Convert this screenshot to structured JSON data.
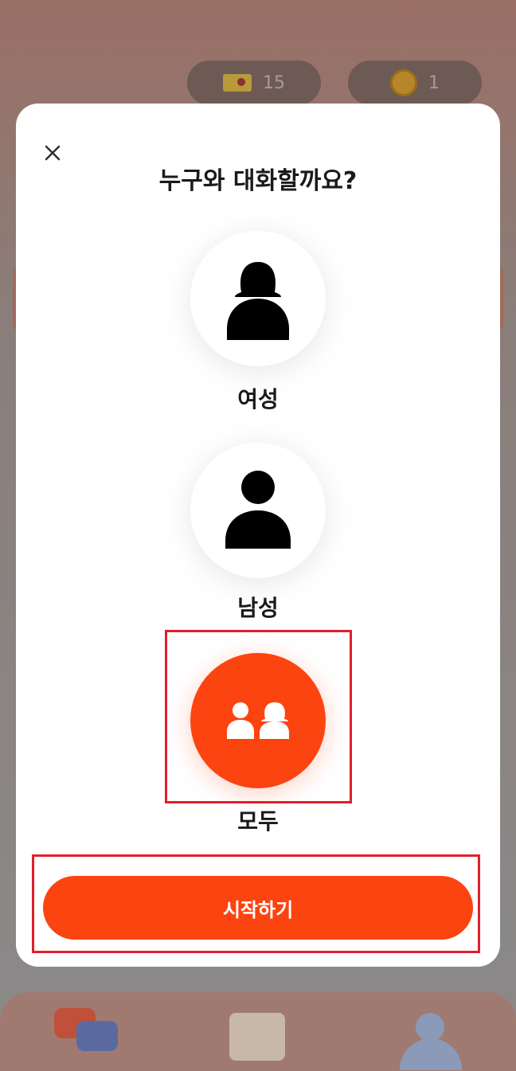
{
  "background": {
    "tickets_count": "15",
    "coins_count": "1",
    "nav": {
      "chat_icon": "chat-bubbles-icon",
      "calendar_icon": "calendar-icon",
      "profile_icon": "profile-icon"
    }
  },
  "modal": {
    "close_icon": "close-icon",
    "title": "누구와 대화할까요?",
    "options": [
      {
        "label": "여성",
        "icon": "female-icon",
        "selected": false
      },
      {
        "label": "남성",
        "icon": "male-icon",
        "selected": false
      },
      {
        "label": "모두",
        "icon": "both-genders-icon",
        "selected": true
      }
    ],
    "start_label": "시작하기"
  },
  "colors": {
    "accent": "#fb4410",
    "highlight": "#e0202a",
    "text": "#1a1a1a"
  }
}
